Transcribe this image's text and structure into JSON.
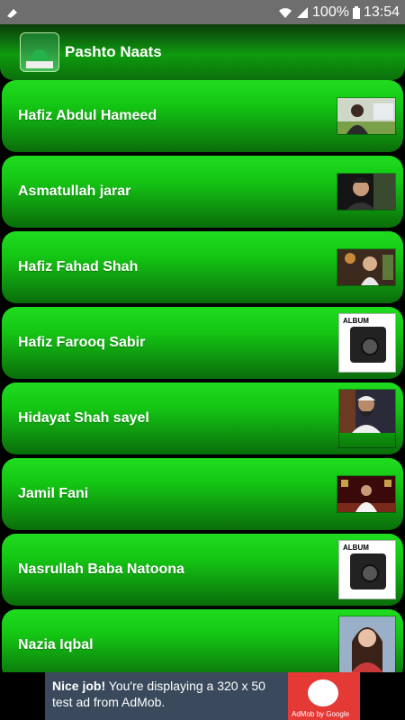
{
  "status_bar": {
    "battery": "100%",
    "time": "13:54",
    "icons": [
      "notification-icon",
      "wifi-icon",
      "signal-icon",
      "battery-icon"
    ]
  },
  "app_bar": {
    "title": "Pashto Naats",
    "icon": "app-logo"
  },
  "list": {
    "items": [
      {
        "label": "Hafiz Abdul Hameed",
        "thumb": "photo"
      },
      {
        "label": "Asmatullah jarar",
        "thumb": "photo"
      },
      {
        "label": "Hafiz Fahad Shah",
        "thumb": "photo"
      },
      {
        "label": "Hafiz Farooq Sabir",
        "thumb": "album"
      },
      {
        "label": "Hidayat Shah sayel",
        "thumb": "photo"
      },
      {
        "label": "Jamil Fani",
        "thumb": "photo"
      },
      {
        "label": "Nasrullah Baba Natoona",
        "thumb": "album"
      },
      {
        "label": "Nazia Iqbal",
        "thumb": "photo"
      }
    ]
  },
  "ad": {
    "headline": "Nice job!",
    "body": "You're displaying a 320 x 50 test ad from AdMob.",
    "brand": "AdMob by Google"
  },
  "album_label": "ALBUM"
}
